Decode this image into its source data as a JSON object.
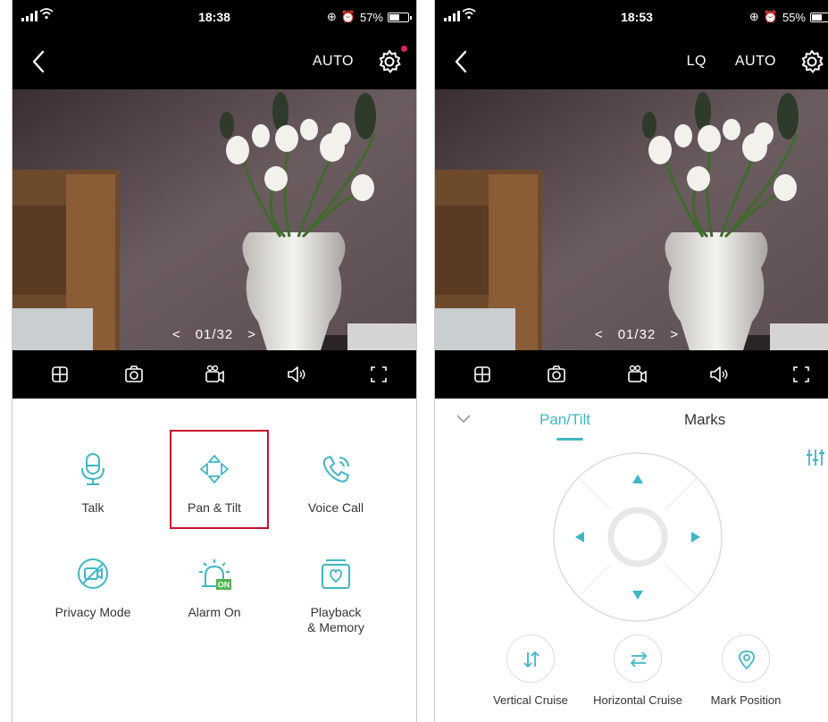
{
  "colors": {
    "accent": "#3fb6c6",
    "highlight": "#c8102e",
    "alarm_badge": "#4fb34a",
    "notify_dot": "#e0245e"
  },
  "left_screen": {
    "status": {
      "time": "18:38",
      "battery": "57%",
      "battery_level": 0.57
    },
    "nav": {
      "quality": "AUTO"
    },
    "video": {
      "counter": "01/32",
      "prev": "<",
      "next": ">"
    },
    "features": [
      {
        "label": "Talk",
        "icon": "microphone-icon"
      },
      {
        "label": "Pan & Tilt",
        "icon": "pan-tilt-icon"
      },
      {
        "label": "Voice Call",
        "icon": "phone-call-icon"
      },
      {
        "label": "Privacy Mode",
        "icon": "privacy-mode-icon"
      },
      {
        "label": "Alarm On",
        "icon": "alarm-icon",
        "badge": "ON"
      },
      {
        "label": "Playback\n& Memory",
        "icon": "playback-icon"
      }
    ]
  },
  "right_screen": {
    "status": {
      "time": "18:53",
      "battery": "55%",
      "battery_level": 0.55
    },
    "nav": {
      "lq": "LQ",
      "quality": "AUTO"
    },
    "video": {
      "counter": "01/32",
      "prev": "<",
      "next": ">"
    },
    "tabs": [
      {
        "label": "Pan/Tilt",
        "active": true
      },
      {
        "label": "Marks",
        "active": false
      }
    ],
    "cruise": [
      {
        "label": "Vertical Cruise",
        "icon": "vertical-cruise-icon"
      },
      {
        "label": "Horizontal Cruise",
        "icon": "horizontal-cruise-icon"
      },
      {
        "label": "Mark Position",
        "icon": "location-pin-icon"
      }
    ]
  }
}
